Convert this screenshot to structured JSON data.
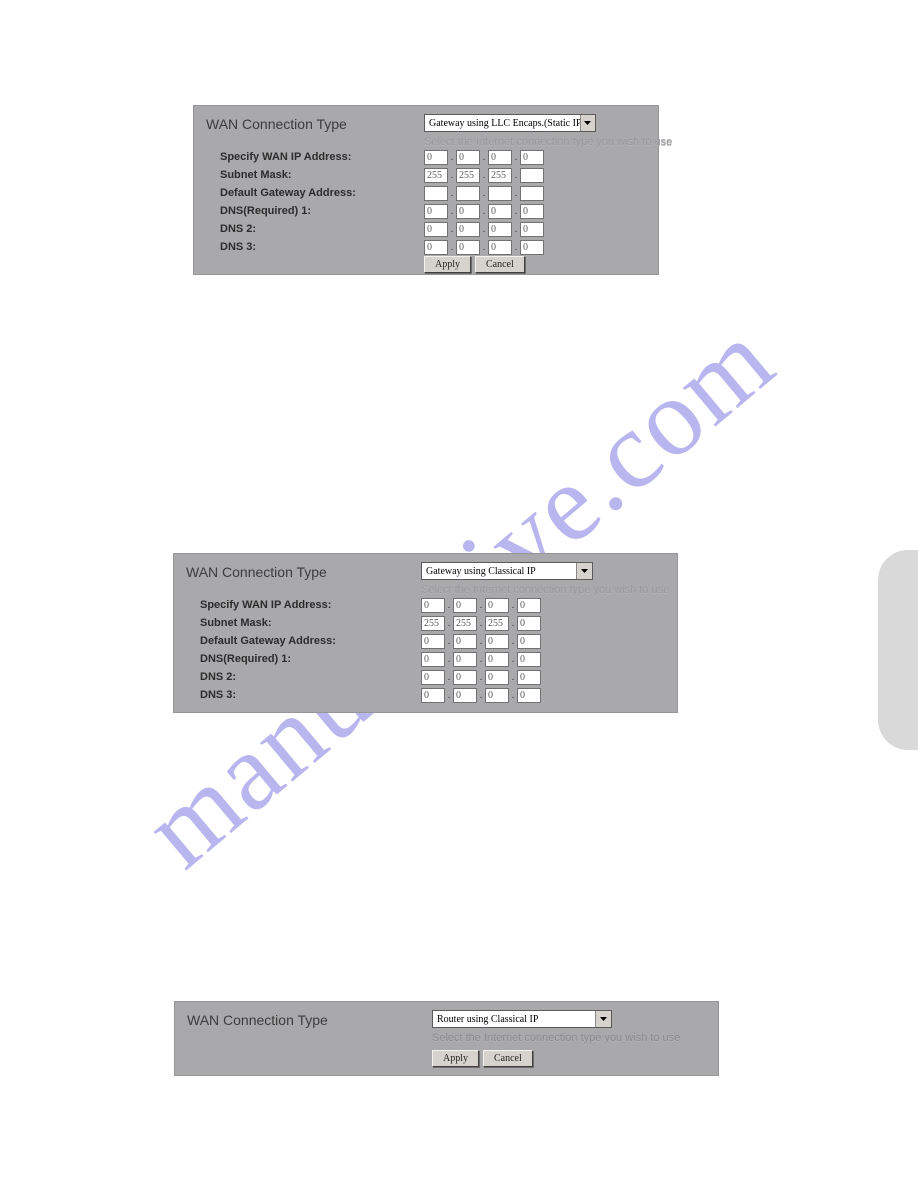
{
  "watermark": "manualslive.com",
  "panel1": {
    "title": "WAN Connection Type",
    "select": "Gateway using LLC Encaps.(Static IP)",
    "subtext": "Select the Internet connection type you wish to use",
    "labels": [
      "Specify WAN IP Address:",
      "Subnet Mask:",
      "Default Gateway Address:",
      "DNS(Required)   1:",
      "DNS   2:",
      "DNS   3:"
    ],
    "rows": [
      [
        "0",
        "0",
        "0",
        "0"
      ],
      [
        "255",
        "255",
        "255",
        ""
      ],
      [
        "",
        "",
        "",
        ""
      ],
      [
        "0",
        "0",
        "0",
        "0"
      ],
      [
        "0",
        "0",
        "0",
        "0"
      ],
      [
        "0",
        "0",
        "0",
        "0"
      ]
    ],
    "apply": "Apply",
    "cancel": "Cancel"
  },
  "panel2": {
    "title": "WAN Connection Type",
    "select": "Gateway using Classical IP",
    "subtext": "Select the Internet connection type you wish to use",
    "labels": [
      "Specify WAN IP Address:",
      "Subnet Mask:",
      "Default Gateway Address:",
      "DNS(Required)   1:",
      "DNS   2:",
      "DNS   3:"
    ],
    "rows": [
      [
        "0",
        "0",
        "0",
        "0"
      ],
      [
        "255",
        "255",
        "255",
        "0"
      ],
      [
        "0",
        "0",
        "0",
        "0"
      ],
      [
        "0",
        "0",
        "0",
        "0"
      ],
      [
        "0",
        "0",
        "0",
        "0"
      ],
      [
        "0",
        "0",
        "0",
        "0"
      ]
    ]
  },
  "panel3": {
    "title": "WAN Connection Type",
    "select": "Router using Classical IP",
    "subtext": "Select the Internet connection type you wish to use",
    "apply": "Apply",
    "cancel": "Cancel"
  }
}
